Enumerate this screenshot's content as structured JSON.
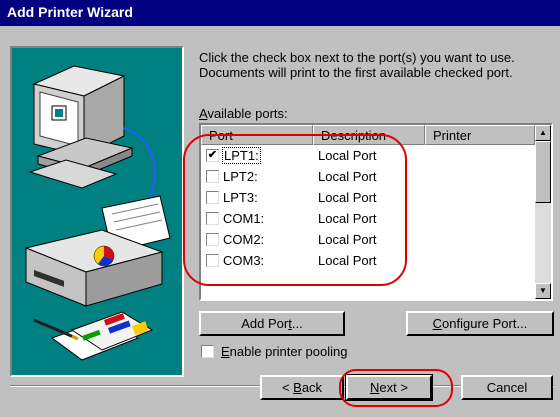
{
  "window": {
    "title": "Add Printer Wizard"
  },
  "instructions": "Click the check box next to the port(s) you want to use. Documents will print to the first available checked port.",
  "available_ports": {
    "label_first": "A",
    "label_rest": "vailable ports:",
    "columns": [
      "Port",
      "Description",
      "Printer"
    ],
    "rows": [
      {
        "port": "LPT1:",
        "description": "Local Port",
        "printer": "",
        "checked": true,
        "selected": true
      },
      {
        "port": "LPT2:",
        "description": "Local Port",
        "printer": "",
        "checked": false,
        "selected": false
      },
      {
        "port": "LPT3:",
        "description": "Local Port",
        "printer": "",
        "checked": false,
        "selected": false
      },
      {
        "port": "COM1:",
        "description": "Local Port",
        "printer": "",
        "checked": false,
        "selected": false
      },
      {
        "port": "COM2:",
        "description": "Local Port",
        "printer": "",
        "checked": false,
        "selected": false
      },
      {
        "port": "COM3:",
        "description": "Local Port",
        "printer": "",
        "checked": false,
        "selected": false
      }
    ]
  },
  "buttons": {
    "add_port": {
      "before": "Add Por",
      "mnemonic": "t",
      "after": "..."
    },
    "configure_port": {
      "before": "",
      "mnemonic": "C",
      "after": "onfigure Port..."
    },
    "back": {
      "before": "< ",
      "mnemonic": "B",
      "after": "ack"
    },
    "next": {
      "before": "",
      "mnemonic": "N",
      "after": "ext >"
    },
    "cancel": "Cancel"
  },
  "pooling": {
    "checked": false,
    "mnemonic": "E",
    "label_rest": "nable printer pooling"
  },
  "colors": {
    "title_bar": "#000080",
    "illustration_bg": "#008080",
    "highlight_ring": "#e00000"
  },
  "icons": [
    "computer-icon",
    "printer-icon",
    "documents-icon"
  ]
}
